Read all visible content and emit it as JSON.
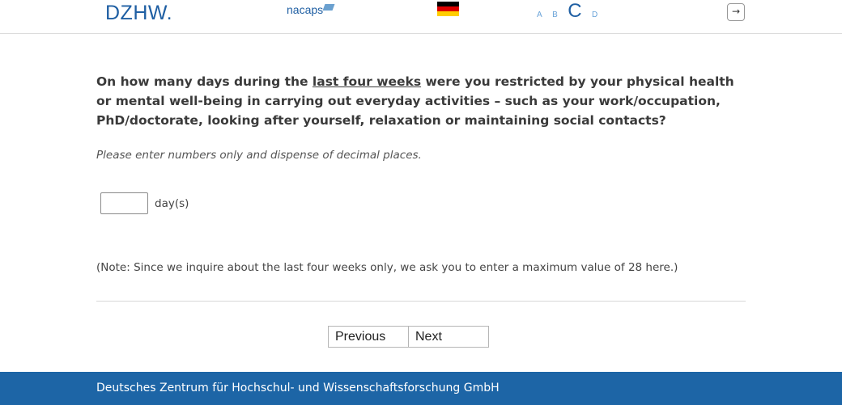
{
  "header": {
    "logo_text": "DZHW.",
    "nacaps_text": "nacaps",
    "flag_colors": [
      "#000000",
      "#dd0000",
      "#ffce00"
    ],
    "font_size_options": [
      "A",
      "B",
      "C",
      "D"
    ],
    "exit_icon": "→"
  },
  "question": {
    "text_before": "On how many days during the ",
    "text_underlined": "last four weeks",
    "text_after": " were you restricted by your physical health or mental well-being in carrying out everyday activities – such as your work/occupation, PhD/doctorate, looking after yourself, relaxation or maintaining social contacts?"
  },
  "instruction": "Please enter numbers only and dispense of decimal places.",
  "answer": {
    "value": "",
    "unit": "day(s)"
  },
  "note": "(Note: Since we inquire about the last four weeks only, we ask you to enter a maximum value of 28 here.)",
  "navigation": {
    "previous_label": "Previous",
    "next_label": "Next"
  },
  "footer": {
    "text": "Deutsches Zentrum für Hochschul- und Wissenschaftsforschung GmbH"
  },
  "colors": {
    "brand_blue": "#1d65a6",
    "font_size_inactive": "#6aa3d8"
  }
}
